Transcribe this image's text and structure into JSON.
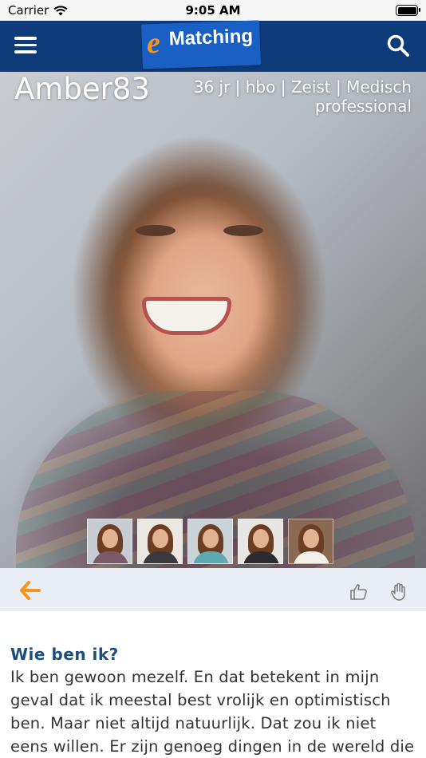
{
  "status_bar": {
    "carrier": "Carrier",
    "time": "9:05 AM",
    "battery_level": 1.0
  },
  "header": {
    "logo_e": "e",
    "logo_text": "Matching",
    "menu_icon": "hamburger-menu-icon",
    "search_icon": "search-icon",
    "background_color": "#0d3b7a",
    "logo_color": "#1a5fc4",
    "accent_color": "#f7941d"
  },
  "profile": {
    "name": "Amber83",
    "meta": "36 jr | hbo | Zeist | Medisch professional"
  },
  "photo_thumbnails": [
    {
      "label": "photo-1"
    },
    {
      "label": "photo-2"
    },
    {
      "label": "photo-3"
    },
    {
      "label": "photo-4"
    },
    {
      "label": "photo-5"
    }
  ],
  "action_bar": {
    "back_icon": "arrow-left-icon",
    "like_icon": "thumbs-up-icon",
    "stop_icon": "raised-hand-icon",
    "back_color": "#f7941d"
  },
  "about": {
    "title": "Wie ben ik?",
    "text": "Ik ben gewoon mezelf. En dat betekent in mijn geval dat ik meestal best vrolijk en optimistisch ben. Maar niet altijd natuurlijk. Dat zou ik niet eens willen. Er zijn genoeg dingen in de wereld die echt wel beter zouden"
  }
}
